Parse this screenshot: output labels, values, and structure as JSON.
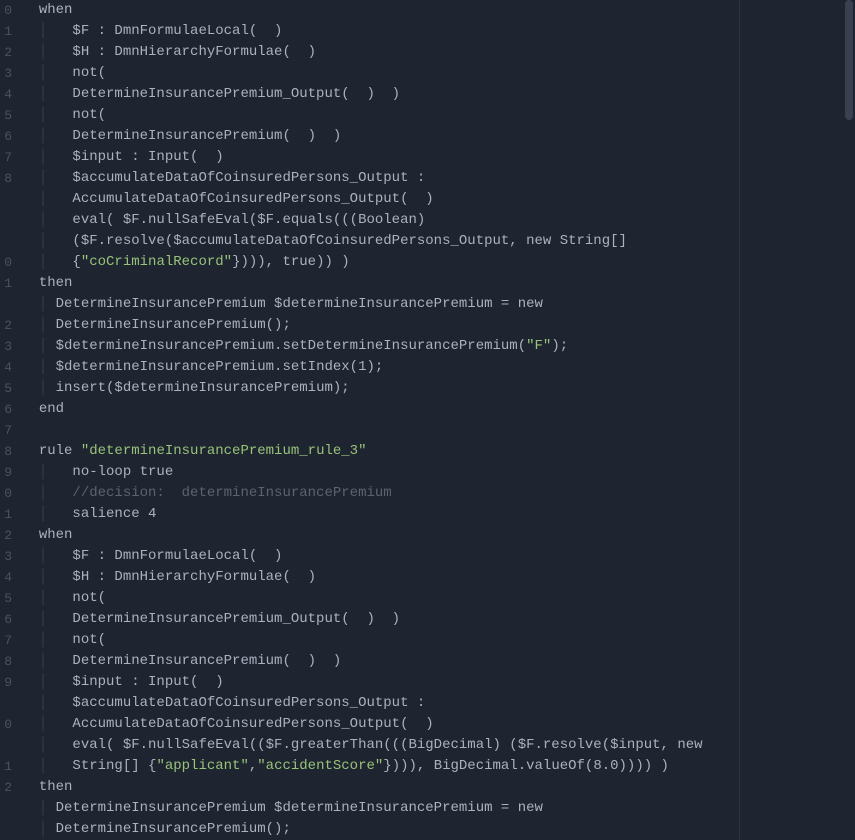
{
  "gutter": [
    "0",
    "1",
    "2",
    "3",
    "4",
    "5",
    "6",
    "7",
    "8",
    "",
    "",
    "",
    "0",
    "1",
    "",
    "2",
    "3",
    "4",
    "5",
    "6",
    "7",
    "8",
    "9",
    "0",
    "1",
    "2",
    "3",
    "4",
    "5",
    "6",
    "7",
    "8",
    "9",
    "",
    "0",
    "",
    "1",
    "2",
    ""
  ],
  "code_lines": [
    {
      "indent": 1,
      "segs": [
        {
          "c": "txt",
          "t": "when"
        }
      ]
    },
    {
      "indent": 1,
      "segs": [
        {
          "c": "guide",
          "t": "│   "
        },
        {
          "c": "txt",
          "t": "$F : DmnFormulaeLocal(  )"
        }
      ]
    },
    {
      "indent": 1,
      "segs": [
        {
          "c": "guide",
          "t": "│   "
        },
        {
          "c": "txt",
          "t": "$H : DmnHierarchyFormulae(  )"
        }
      ]
    },
    {
      "indent": 1,
      "segs": [
        {
          "c": "guide",
          "t": "│   "
        },
        {
          "c": "txt",
          "t": "not("
        }
      ]
    },
    {
      "indent": 1,
      "segs": [
        {
          "c": "guide",
          "t": "│   "
        },
        {
          "c": "txt",
          "t": "DetermineInsurancePremium_Output(  )  )"
        }
      ]
    },
    {
      "indent": 1,
      "segs": [
        {
          "c": "guide",
          "t": "│   "
        },
        {
          "c": "txt",
          "t": "not("
        }
      ]
    },
    {
      "indent": 1,
      "segs": [
        {
          "c": "guide",
          "t": "│   "
        },
        {
          "c": "txt",
          "t": "DetermineInsurancePremium(  )  )"
        }
      ]
    },
    {
      "indent": 1,
      "segs": [
        {
          "c": "guide",
          "t": "│   "
        },
        {
          "c": "txt",
          "t": "$input : Input(  )"
        }
      ]
    },
    {
      "indent": 1,
      "segs": [
        {
          "c": "guide",
          "t": "│   "
        },
        {
          "c": "txt",
          "t": "$accumulateDataOfCoinsuredPersons_Output :"
        }
      ]
    },
    {
      "indent": 1,
      "segs": [
        {
          "c": "guide",
          "t": "│   "
        },
        {
          "c": "txt",
          "t": "AccumulateDataOfCoinsuredPersons_Output(  )"
        }
      ]
    },
    {
      "indent": 1,
      "segs": [
        {
          "c": "guide",
          "t": "│   "
        },
        {
          "c": "txt",
          "t": "eval( $F.nullSafeEval($F.equals(((Boolean)"
        }
      ]
    },
    {
      "indent": 1,
      "segs": [
        {
          "c": "guide",
          "t": "│   "
        },
        {
          "c": "txt",
          "t": "($F.resolve($accumulateDataOfCoinsuredPersons_Output, new String[]"
        }
      ]
    },
    {
      "indent": 1,
      "segs": [
        {
          "c": "guide",
          "t": "│   "
        },
        {
          "c": "txt",
          "t": "{"
        },
        {
          "c": "str",
          "t": "\"coCriminalRecord\""
        },
        {
          "c": "txt",
          "t": "}))), true)) )"
        }
      ]
    },
    {
      "indent": 1,
      "segs": [
        {
          "c": "txt",
          "t": "then"
        }
      ]
    },
    {
      "indent": 1,
      "segs": [
        {
          "c": "guide",
          "t": "│ "
        },
        {
          "c": "txt",
          "t": "DetermineInsurancePremium $determineInsurancePremium = new"
        }
      ]
    },
    {
      "indent": 1,
      "segs": [
        {
          "c": "guide",
          "t": "│ "
        },
        {
          "c": "txt",
          "t": "DetermineInsurancePremium();"
        }
      ]
    },
    {
      "indent": 1,
      "segs": [
        {
          "c": "guide",
          "t": "│ "
        },
        {
          "c": "txt",
          "t": "$determineInsurancePremium.setDetermineInsurancePremium("
        },
        {
          "c": "str",
          "t": "\"F\""
        },
        {
          "c": "txt",
          "t": ");"
        }
      ]
    },
    {
      "indent": 1,
      "segs": [
        {
          "c": "guide",
          "t": "│ "
        },
        {
          "c": "txt",
          "t": "$determineInsurancePremium.setIndex(1);"
        }
      ]
    },
    {
      "indent": 1,
      "segs": [
        {
          "c": "guide",
          "t": "│ "
        },
        {
          "c": "txt",
          "t": "insert($determineInsurancePremium);"
        }
      ]
    },
    {
      "indent": 1,
      "segs": [
        {
          "c": "txt",
          "t": "end"
        }
      ]
    },
    {
      "indent": 0,
      "segs": [
        {
          "c": "txt",
          "t": ""
        }
      ]
    },
    {
      "indent": 1,
      "segs": [
        {
          "c": "txt",
          "t": "rule "
        },
        {
          "c": "str",
          "t": "\"determineInsurancePremium_rule_3\""
        }
      ]
    },
    {
      "indent": 1,
      "segs": [
        {
          "c": "guide",
          "t": "│   "
        },
        {
          "c": "txt",
          "t": "no-loop true"
        }
      ]
    },
    {
      "indent": 1,
      "segs": [
        {
          "c": "guide",
          "t": "│   "
        },
        {
          "c": "comment",
          "t": "//decision:  determineInsurancePremium"
        }
      ]
    },
    {
      "indent": 1,
      "segs": [
        {
          "c": "guide",
          "t": "│   "
        },
        {
          "c": "txt",
          "t": "salience 4"
        }
      ]
    },
    {
      "indent": 1,
      "segs": [
        {
          "c": "txt",
          "t": "when"
        }
      ]
    },
    {
      "indent": 1,
      "segs": [
        {
          "c": "guide",
          "t": "│   "
        },
        {
          "c": "txt",
          "t": "$F : DmnFormulaeLocal(  )"
        }
      ]
    },
    {
      "indent": 1,
      "segs": [
        {
          "c": "guide",
          "t": "│   "
        },
        {
          "c": "txt",
          "t": "$H : DmnHierarchyFormulae(  )"
        }
      ]
    },
    {
      "indent": 1,
      "segs": [
        {
          "c": "guide",
          "t": "│   "
        },
        {
          "c": "txt",
          "t": "not("
        }
      ]
    },
    {
      "indent": 1,
      "segs": [
        {
          "c": "guide",
          "t": "│   "
        },
        {
          "c": "txt",
          "t": "DetermineInsurancePremium_Output(  )  )"
        }
      ]
    },
    {
      "indent": 1,
      "segs": [
        {
          "c": "guide",
          "t": "│   "
        },
        {
          "c": "txt",
          "t": "not("
        }
      ]
    },
    {
      "indent": 1,
      "segs": [
        {
          "c": "guide",
          "t": "│   "
        },
        {
          "c": "txt",
          "t": "DetermineInsurancePremium(  )  )"
        }
      ]
    },
    {
      "indent": 1,
      "segs": [
        {
          "c": "guide",
          "t": "│   "
        },
        {
          "c": "txt",
          "t": "$input : Input(  )"
        }
      ]
    },
    {
      "indent": 1,
      "segs": [
        {
          "c": "guide",
          "t": "│   "
        },
        {
          "c": "txt",
          "t": "$accumulateDataOfCoinsuredPersons_Output :"
        }
      ]
    },
    {
      "indent": 1,
      "segs": [
        {
          "c": "guide",
          "t": "│   "
        },
        {
          "c": "txt",
          "t": "AccumulateDataOfCoinsuredPersons_Output(  )"
        }
      ]
    },
    {
      "indent": 1,
      "segs": [
        {
          "c": "guide",
          "t": "│   "
        },
        {
          "c": "txt",
          "t": "eval( $F.nullSafeEval(($F.greaterThan(((BigDecimal) ($F.resolve($input, new"
        }
      ]
    },
    {
      "indent": 1,
      "segs": [
        {
          "c": "guide",
          "t": "│   "
        },
        {
          "c": "txt",
          "t": "String[] {"
        },
        {
          "c": "str",
          "t": "\"applicant\""
        },
        {
          "c": "txt",
          "t": ","
        },
        {
          "c": "str",
          "t": "\"accidentScore\""
        },
        {
          "c": "txt",
          "t": "}))), BigDecimal.valueOf(8.0)))) )"
        }
      ]
    },
    {
      "indent": 1,
      "segs": [
        {
          "c": "txt",
          "t": "then"
        }
      ]
    },
    {
      "indent": 1,
      "segs": [
        {
          "c": "guide",
          "t": "│ "
        },
        {
          "c": "txt",
          "t": "DetermineInsurancePremium $determineInsurancePremium = new"
        }
      ]
    },
    {
      "indent": 1,
      "segs": [
        {
          "c": "guide",
          "t": "│ "
        },
        {
          "c": "txt",
          "t": "DetermineInsurancePremium();"
        }
      ]
    }
  ],
  "scrollbar": {
    "thumb_top": 0
  }
}
